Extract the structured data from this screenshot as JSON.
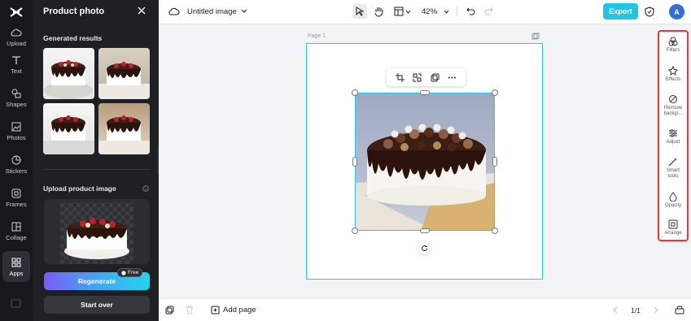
{
  "rail": {
    "items": [
      {
        "label": "Upload",
        "icon": "cloud-upload-icon"
      },
      {
        "label": "Text",
        "icon": "text-icon"
      },
      {
        "label": "Shapes",
        "icon": "shapes-icon"
      },
      {
        "label": "Photos",
        "icon": "photos-icon"
      },
      {
        "label": "Stickers",
        "icon": "stickers-icon"
      },
      {
        "label": "Frames",
        "icon": "frames-icon"
      },
      {
        "label": "Collage",
        "icon": "collage-icon"
      },
      {
        "label": "Apps",
        "icon": "apps-icon"
      }
    ]
  },
  "panel": {
    "title": "Product photo",
    "generated_label": "Generated results",
    "upload_label": "Upload product image",
    "regenerate": "Regenerate",
    "free_badge": "Free",
    "start_over": "Start over"
  },
  "topbar": {
    "doc_title": "Untitled image",
    "zoom": "42%",
    "export": "Export",
    "avatar": "A"
  },
  "canvas": {
    "page_label": "Page 1"
  },
  "right_tools": [
    {
      "label": "Filters",
      "icon": "filters-icon"
    },
    {
      "label": "Effects",
      "icon": "effects-icon"
    },
    {
      "label": "Remove backgr...",
      "icon": "remove-background-icon"
    },
    {
      "label": "Adjust",
      "icon": "adjust-icon"
    },
    {
      "label": "Smart tools",
      "icon": "smart-tools-icon"
    },
    {
      "label": "Opacity",
      "icon": "opacity-icon"
    },
    {
      "label": "Arrange",
      "icon": "arrange-icon"
    }
  ],
  "bottombar": {
    "add_page": "Add page",
    "page_count": "1/1"
  },
  "colors": {
    "accent": "#1ec6e6",
    "selection": "#2ec5e2",
    "highlight": "#e53935"
  }
}
